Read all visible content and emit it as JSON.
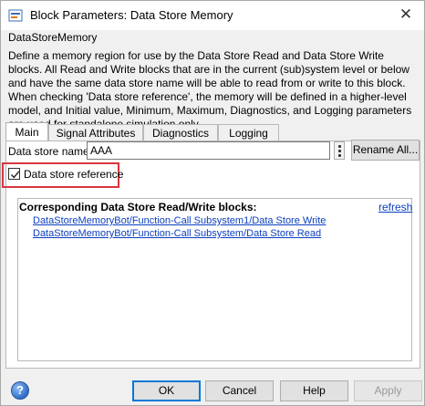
{
  "window": {
    "title": "Block Parameters: Data Store Memory",
    "close_glyph": "✕"
  },
  "block": {
    "type_name": "DataStoreMemory",
    "description": "Define a memory region for use by the Data Store Read and Data Store Write blocks. All Read and Write blocks that are in the current (sub)system level or below and have the same data store name will be able to read from or write to this block. When checking 'Data store reference', the memory will be defined in a higher-level model, and Initial value, Minimum, Maximum, Diagnostics, and Logging parameters are used for standalone simulation only."
  },
  "tabs": [
    {
      "label": "Main",
      "active": true
    },
    {
      "label": "Signal Attributes",
      "active": false
    },
    {
      "label": "Diagnostics",
      "active": false
    },
    {
      "label": "Logging",
      "active": false
    }
  ],
  "main": {
    "data_store_name_label": "Data store name:",
    "data_store_name_value": "AAA",
    "rename_all_label": "Rename All...",
    "data_store_reference_label": "Data store reference",
    "data_store_reference_checked": true,
    "highlight_color": "#d9363e",
    "corresponding": {
      "heading": "Corresponding Data Store Read/Write blocks:",
      "refresh_label": "refresh",
      "links": [
        "DataStoreMemoryBot/Function-Call Subsystem1/Data Store Write",
        "DataStoreMemoryBot/Function-Call Subsystem/Data Store Read"
      ]
    }
  },
  "footer": {
    "help_icon_glyph": "?",
    "ok_label": "OK",
    "cancel_label": "Cancel",
    "help_label": "Help",
    "apply_label": "Apply",
    "apply_enabled": false
  },
  "icons": {
    "app_icon": "simulink-block-icon",
    "help": "help-icon",
    "close": "close-icon",
    "more": "more-options-icon"
  },
  "colors": {
    "link": "#0b3fbf",
    "focus_border": "#0078d7"
  }
}
